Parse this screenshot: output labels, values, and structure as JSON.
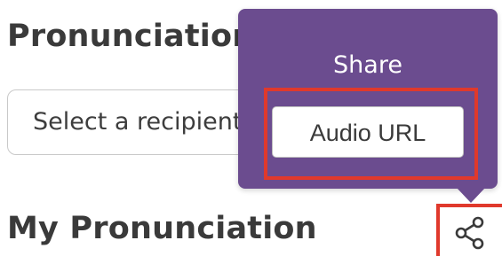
{
  "page": {
    "section_title": "Pronunciation",
    "recipient_select_placeholder": "Select a recipient",
    "my_pronunciation_title": "My Pronunciation"
  },
  "share_popover": {
    "title": "Share",
    "audio_url_label": "Audio URL"
  },
  "icons": {
    "share": "share-icon"
  },
  "colors": {
    "popover_background": "#6b4c8f",
    "highlight": "#e0392c",
    "heading_text": "#3a3a3a"
  }
}
